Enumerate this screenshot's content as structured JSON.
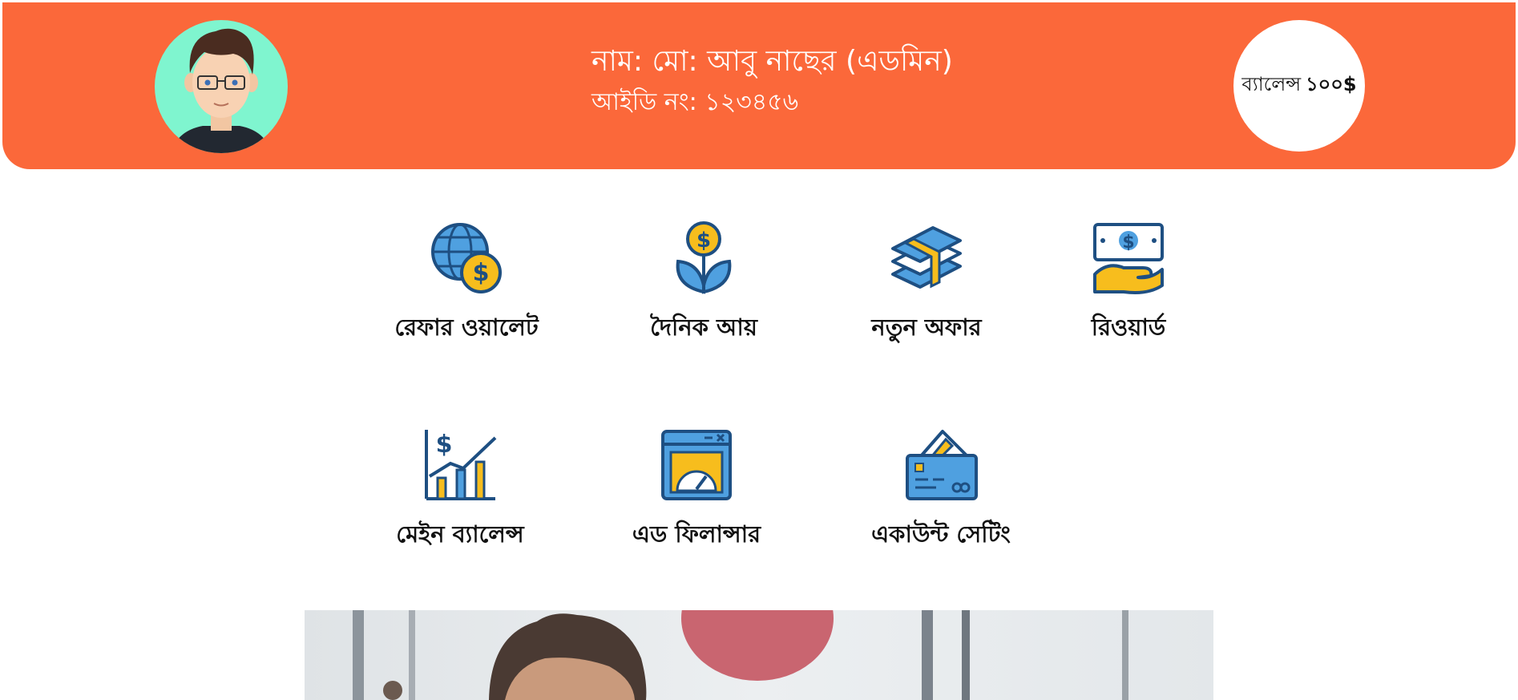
{
  "header": {
    "name": "নাম: মো: আবু নাছের (এডমিন)",
    "id": "আইডি নং: ১২৩৪৫৬",
    "balance_label": "ব্যালেন্স",
    "balance_amount": "১০০$",
    "bg_color": "#fb683a"
  },
  "menu": [
    {
      "label": "রেফার ওয়ালেট",
      "icon": "globe-dollar-icon"
    },
    {
      "label": "দৈনিক আয়",
      "icon": "money-plant-icon"
    },
    {
      "label": "নতুন অফার",
      "icon": "money-stack-icon"
    },
    {
      "label": "রিওয়ার্ড",
      "icon": "hand-cash-icon"
    },
    {
      "label": "মেইন ব্যালেন্স",
      "icon": "growth-chart-icon"
    },
    {
      "label": "এড ফিলান্সার",
      "icon": "browser-speedometer-icon"
    },
    {
      "label": "একাউন্ট সেটিং",
      "icon": "card-wallet-icon"
    }
  ],
  "colors": {
    "icon_blue": "#1e4f82",
    "icon_light_blue": "#4fa0e0",
    "icon_yellow": "#f7bd1d"
  }
}
